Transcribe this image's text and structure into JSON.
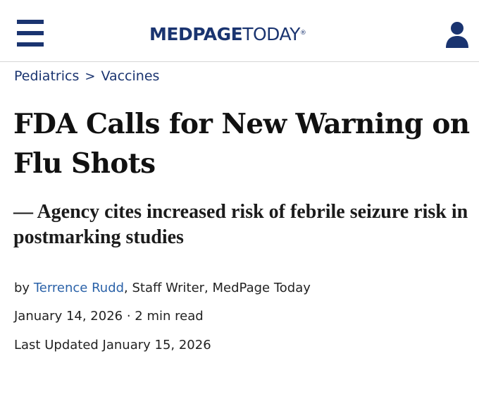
{
  "header": {
    "logo": {
      "part1": "MEDPAGE",
      "part2": "TODAY",
      "mark": "®"
    },
    "menu_icon": "hamburger-icon",
    "user_icon": "user-icon",
    "brand_color": "#1a3470"
  },
  "breadcrumb": {
    "items": [
      {
        "label": "Pediatrics"
      },
      {
        "label": "Vaccines"
      }
    ],
    "separator": ">"
  },
  "article": {
    "title": "FDA Calls for New Warning on Flu Shots",
    "subtitle": "— Agency cites increased risk of febrile seizure risk in postmarking studies",
    "byline": {
      "prefix": "by ",
      "author": "Terrence Rudd",
      "role": ", Staff Writer, MedPage Today"
    },
    "date": "January 14, 2026 · 2 min read",
    "last_updated": "Last Updated January 15, 2026",
    "link_color": "#2b62a8"
  }
}
